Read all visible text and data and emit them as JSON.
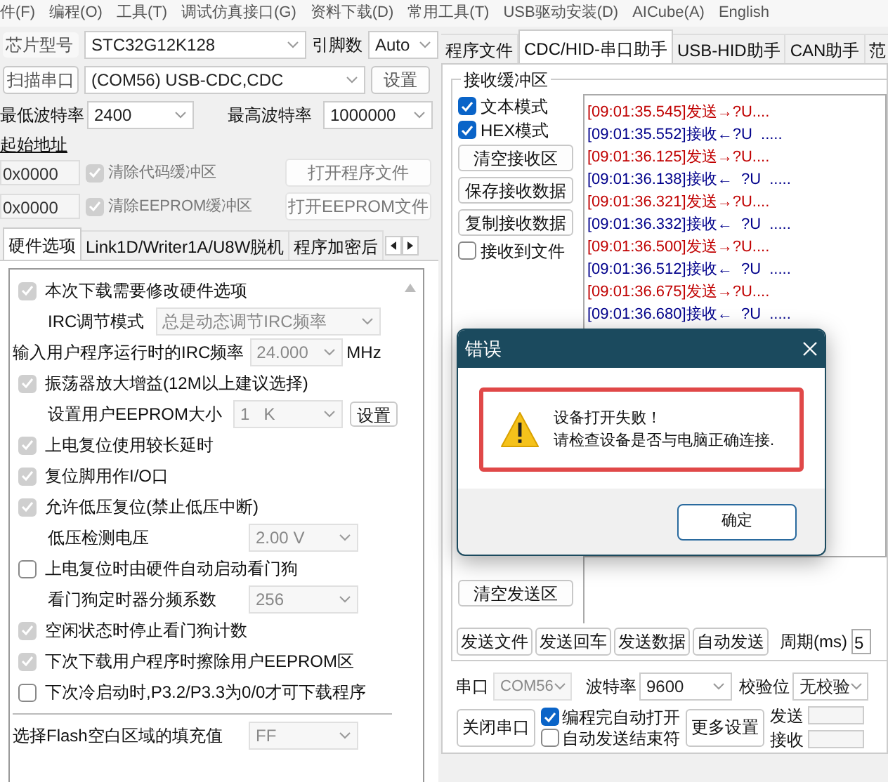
{
  "menu": [
    "件(F)",
    "编程(O)",
    "工具(T)",
    "调试仿真接口(G)",
    "资料下载(D)",
    "常用工具(T)",
    "USB驱动安装(D)",
    "AICube(A)",
    "English"
  ],
  "chip": {
    "label": "芯片型号",
    "value": "STC32G12K128",
    "pins_label": "引脚数",
    "pins_value": "Auto"
  },
  "port": {
    "button": "扫描串口",
    "value": "(COM56) USB-CDC,CDC",
    "settings_button": "设置"
  },
  "baud": {
    "min_label": "最低波特率",
    "min_value": "2400",
    "max_label": "最高波特率",
    "max_value": "1000000"
  },
  "start_address": {
    "label": "起始地址",
    "rows": [
      {
        "value": "0x0000",
        "checkbox": "清除代码缓冲区",
        "checked": true,
        "button": "打开程序文件"
      },
      {
        "value": "0x0000",
        "checkbox": "清除EEPROM缓冲区",
        "checked": true,
        "button": "打开EEPROM文件"
      }
    ]
  },
  "left_tabs": [
    {
      "label": "硬件选项",
      "selected": true
    },
    {
      "label": "Link1D/Writer1A/U8W脱机",
      "selected": false
    },
    {
      "label": "程序加密后",
      "selected": false
    }
  ],
  "options": [
    {
      "kind": "checkbox",
      "label": "本次下载需要修改硬件选项",
      "checked": true
    },
    {
      "kind": "sub_select",
      "label": "IRC调节模式",
      "value": "总是动态调节IRC频率"
    },
    {
      "kind": "select",
      "label": "输入用户程序运行时的IRC频率",
      "value": "24.000",
      "unit": "MHz"
    },
    {
      "kind": "checkbox",
      "label": "振荡器放大增益(12M以上建议选择)",
      "checked": true
    },
    {
      "kind": "sub_select",
      "label": "设置用户EEPROM大小",
      "value": "1   K",
      "button": "设置"
    },
    {
      "kind": "checkbox",
      "label": "上电复位使用较长延时",
      "checked": true
    },
    {
      "kind": "checkbox",
      "label": "复位脚用作I/O口",
      "checked": true
    },
    {
      "kind": "checkbox",
      "label": "允许低压复位(禁止低压中断)",
      "checked": true
    },
    {
      "kind": "sub_select",
      "label": "低压检测电压",
      "value": "2.00 V"
    },
    {
      "kind": "checkbox",
      "label": "上电复位时由硬件自动启动看门狗",
      "checked": false
    },
    {
      "kind": "sub_select",
      "label": "看门狗定时器分频系数",
      "value": "256"
    },
    {
      "kind": "checkbox",
      "label": "空闲状态时停止看门狗计数",
      "checked": true
    },
    {
      "kind": "checkbox",
      "label": "下次下载用户程序时擦除用户EEPROM区",
      "checked": true
    },
    {
      "kind": "checkbox",
      "label": "下次冷启动时,P3.2/P3.3为0/0才可下载程序",
      "checked": false
    },
    {
      "kind": "divider"
    },
    {
      "kind": "select",
      "label": "选择Flash空白区域的填充值",
      "value": "FF"
    }
  ],
  "right_tabs": [
    {
      "label": "程序文件",
      "selected": false
    },
    {
      "label": "CDC/HID-串口助手",
      "selected": true
    },
    {
      "label": "USB-HID助手",
      "selected": false
    },
    {
      "label": "CAN助手",
      "selected": false
    },
    {
      "label": "范",
      "selected": false
    }
  ],
  "receive": {
    "title": "接收缓冲区",
    "controls": [
      {
        "kind": "checkbox",
        "label": "文本模式",
        "checked": true
      },
      {
        "kind": "checkbox",
        "label": "HEX模式",
        "checked": true
      },
      {
        "kind": "button",
        "label": "清空接收区"
      },
      {
        "kind": "button",
        "label": "保存接收数据"
      },
      {
        "kind": "button",
        "label": "复制接收数据"
      },
      {
        "kind": "checkbox",
        "label": "接收到文件",
        "checked": false
      }
    ],
    "log": [
      {
        "kind": "send",
        "text": "[09:01:35.545]发送→?U...."
      },
      {
        "kind": "recv",
        "text": "[09:01:35.552]接收←?U  ....."
      },
      {
        "kind": "send",
        "text": "[09:01:36.125]发送→?U...."
      },
      {
        "kind": "recv",
        "text": "[09:01:36.138]接收←  ?U  ....."
      },
      {
        "kind": "send",
        "text": "[09:01:36.321]发送→?U...."
      },
      {
        "kind": "recv",
        "text": "[09:01:36.332]接收←  ?U  ....."
      },
      {
        "kind": "send",
        "text": "[09:01:36.500]发送→?U...."
      },
      {
        "kind": "recv",
        "text": "[09:01:36.512]接收←  ?U  ....."
      },
      {
        "kind": "send",
        "text": "[09:01:36.675]发送→?U...."
      },
      {
        "kind": "recv",
        "text": "[09:01:36.680]接收←  ?U  ....."
      }
    ]
  },
  "send": {
    "clear_button": "清空发送区",
    "buttons": [
      "发送文件",
      "发送回车",
      "发送数据",
      "自动发送"
    ],
    "period_label": "周期(ms)",
    "period_value": "5"
  },
  "serial": {
    "port_label": "串口",
    "port_value": "COM56",
    "baud_label": "波特率",
    "baud_value": "9600",
    "parity_label": "校验位",
    "parity_value": "无校验"
  },
  "bottom": {
    "close_button": "关闭串口",
    "checks": [
      {
        "label": "编程完自动打开",
        "checked": true
      },
      {
        "label": "自动发送结束符",
        "checked": false
      }
    ],
    "more_button": "更多设置",
    "send_label": "发送",
    "recv_label": "接收"
  },
  "dialog": {
    "title": "错误",
    "lines": [
      "设备打开失败！",
      "请检查设备是否与电脑正确连接."
    ],
    "ok": "确定"
  }
}
